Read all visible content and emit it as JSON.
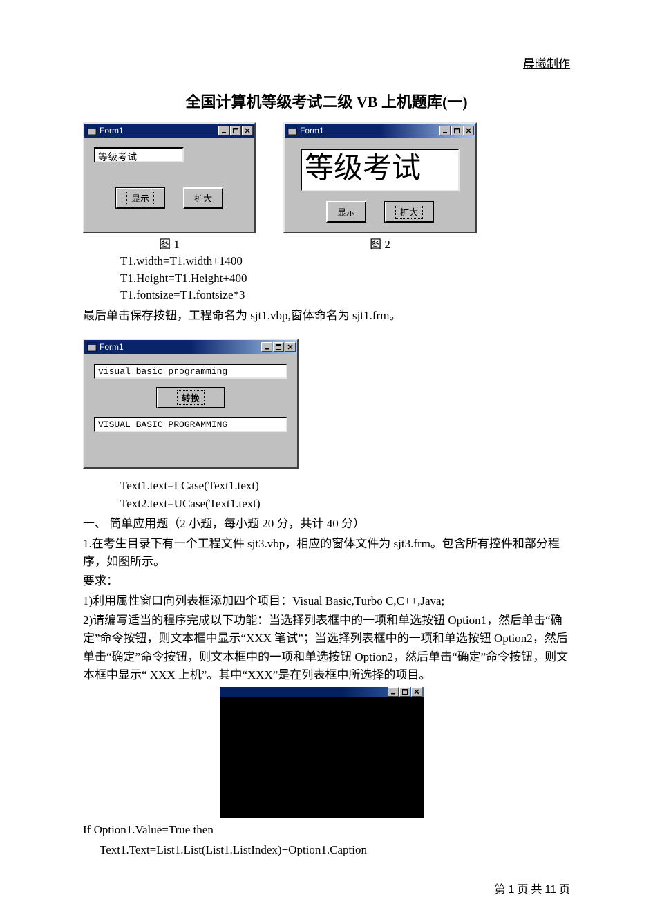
{
  "header_right": "晨曦制作",
  "doc_title": "全国计算机等级考试二级 VB 上机题库(一)",
  "fig1": {
    "caption": "图 1",
    "title": "Form1",
    "textbox": "等级考试",
    "btn1": "显示",
    "btn2": "扩大"
  },
  "fig2": {
    "caption": "图 2",
    "title": "Form1",
    "textbox": "等级考试",
    "btn1": "显示",
    "btn2": "扩大"
  },
  "fig3": {
    "title": "Form1",
    "text1": "visual basic programming",
    "btn": "转换",
    "text2": "VISUAL BASIC PROGRAMMING"
  },
  "code1": {
    "l1": "T1.width=T1.width+1400",
    "l2": "T1.Height=T1.Height+400",
    "l3": "T1.fontsize=T1.fontsize*3"
  },
  "para1": "最后单击保存按钮，工程命名为 sjt1.vbp,窗体命名为 sjt1.frm。",
  "code2": {
    "l1": "Text1.text=LCase(Text1.text)",
    "l2": "Text2.text=UCase(Text1.text)"
  },
  "body": {
    "l1": "一、 简单应用题（2 小题，每小题 20 分，共计 40 分）",
    "l2": "1.在考生目录下有一个工程文件 sjt3.vbp，相应的窗体文件为 sjt3.frm。包含所有控件和部分程序，如图所示。",
    "l3": "要求：",
    "l4": "1)利用属性窗口向列表框添加四个项目：Visual Basic,Turbo C,C++,Java;",
    "l5": "2)请编写适当的程序完成以下功能：当选择列表框中的一项和单选按钮 Option1，然后单击“确定”命令按钮，则文本框中显示“XXX 笔试”；当选择列表框中的一项和单选按钮 Option2，然后单击“确定”命令按钮，则文本框中的一项和单选按钮 Option2，然后单击“确定”命令按钮，则文本框中显示“ XXX 上机”。其中“XXX”是在列表框中所选择的项目。"
  },
  "code3": {
    "l1": "If Option1.Value=True then",
    "l2": "  Text1.Text=List1.List(List1.ListIndex)+Option1.Caption"
  },
  "footer": {
    "prefix": "第 ",
    "page": "1",
    "mid": " 页 共 ",
    "total": "11",
    "suffix": " 页"
  }
}
